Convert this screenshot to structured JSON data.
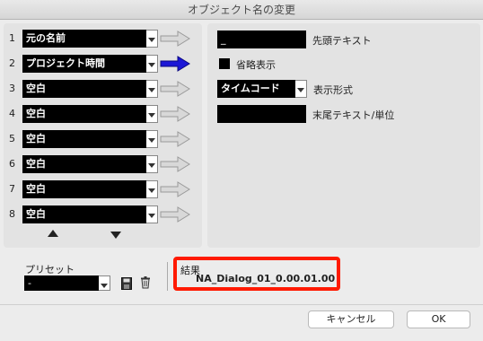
{
  "window": {
    "title": "オブジェクト名の変更"
  },
  "left": {
    "rows": [
      {
        "num": "1",
        "value": "元の名前",
        "active": false
      },
      {
        "num": "2",
        "value": "プロジェクト時間",
        "active": true
      },
      {
        "num": "3",
        "value": "空白",
        "active": false
      },
      {
        "num": "4",
        "value": "空白",
        "active": false
      },
      {
        "num": "5",
        "value": "空白",
        "active": false
      },
      {
        "num": "6",
        "value": "空白",
        "active": false
      },
      {
        "num": "7",
        "value": "空白",
        "active": false
      },
      {
        "num": "8",
        "value": "空白",
        "active": false
      }
    ]
  },
  "right": {
    "prefix_value": "_",
    "prefix_label": "先頭テキスト",
    "abbrev_label": "省略表示",
    "format_value": "タイムコード",
    "format_label": "表示形式",
    "suffix_value": "",
    "suffix_label": "末尾テキスト/単位"
  },
  "preset": {
    "label": "プリセット",
    "value": "-"
  },
  "result": {
    "label": "結果",
    "value": "NA_Dialog_01_0.00.01.00"
  },
  "buttons": {
    "cancel": "キャンセル",
    "ok": "OK"
  },
  "colors": {
    "active_arrow": "#1c17d6",
    "inactive_arrow": "#bdbdbd",
    "highlight": "#ff1a00"
  }
}
